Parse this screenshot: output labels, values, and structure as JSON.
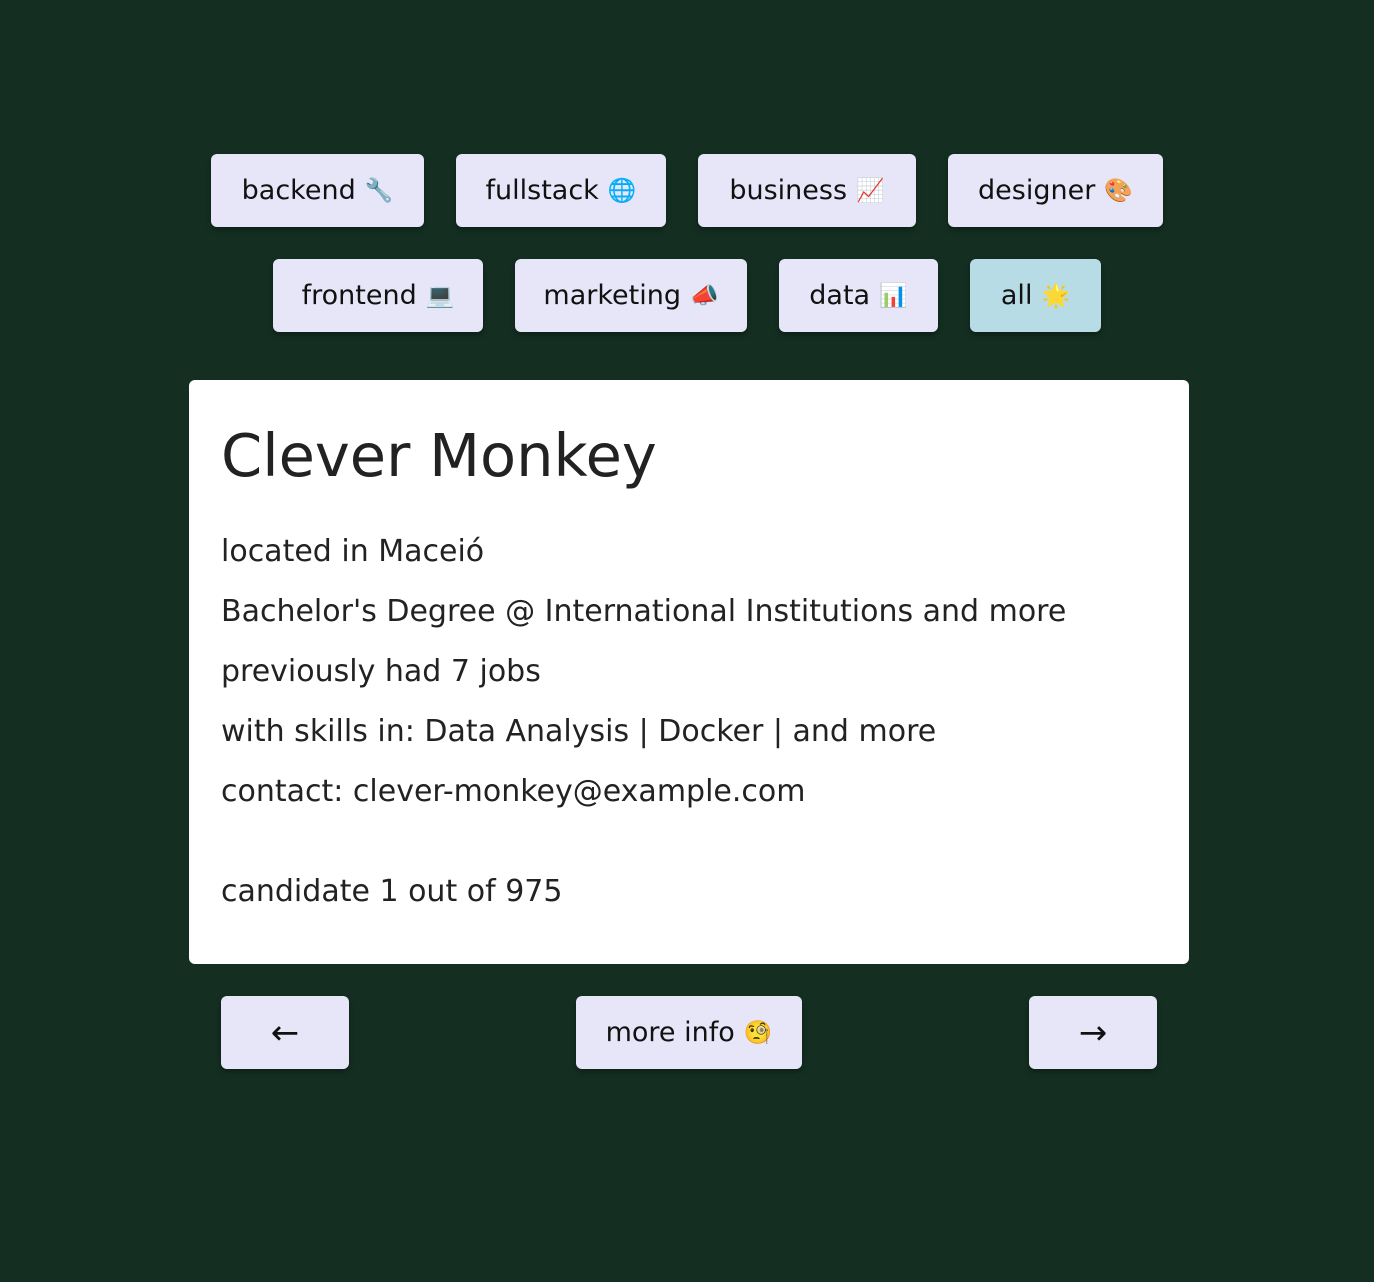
{
  "filters": {
    "row1": [
      {
        "label": "backend",
        "emoji": "🔧",
        "width": 213,
        "active": false
      },
      {
        "label": "fullstack",
        "emoji": "🌐",
        "width": 210,
        "active": false
      },
      {
        "label": "business",
        "emoji": "📈",
        "width": 218,
        "active": false
      },
      {
        "label": "designer",
        "emoji": "🎨",
        "width": 215,
        "active": false
      }
    ],
    "row2": [
      {
        "label": "frontend",
        "emoji": "💻",
        "width": 210,
        "active": false
      },
      {
        "label": "marketing",
        "emoji": "📣",
        "width": 232,
        "active": false
      },
      {
        "label": "data",
        "emoji": "📊",
        "width": 159,
        "active": false
      },
      {
        "label": "all",
        "emoji": "🌟",
        "width": 131,
        "active": true
      }
    ]
  },
  "candidate": {
    "name": "Clever Monkey",
    "location": "located in Maceió",
    "education": "Bachelor's Degree @ International Institutions and more",
    "jobs": "previously had 7 jobs",
    "skills": "with skills in: Data Analysis | Docker | and more",
    "contact": "contact: clever-monkey@example.com",
    "counter": "candidate 1 out of 975"
  },
  "nav": {
    "prev_label": "←",
    "more_label": "more info",
    "more_emoji": "🧐",
    "next_label": "→"
  },
  "colors": {
    "background": "#142f22",
    "button": "#e6e6f8",
    "button_active": "#b8dce6",
    "card": "#ffffff"
  }
}
